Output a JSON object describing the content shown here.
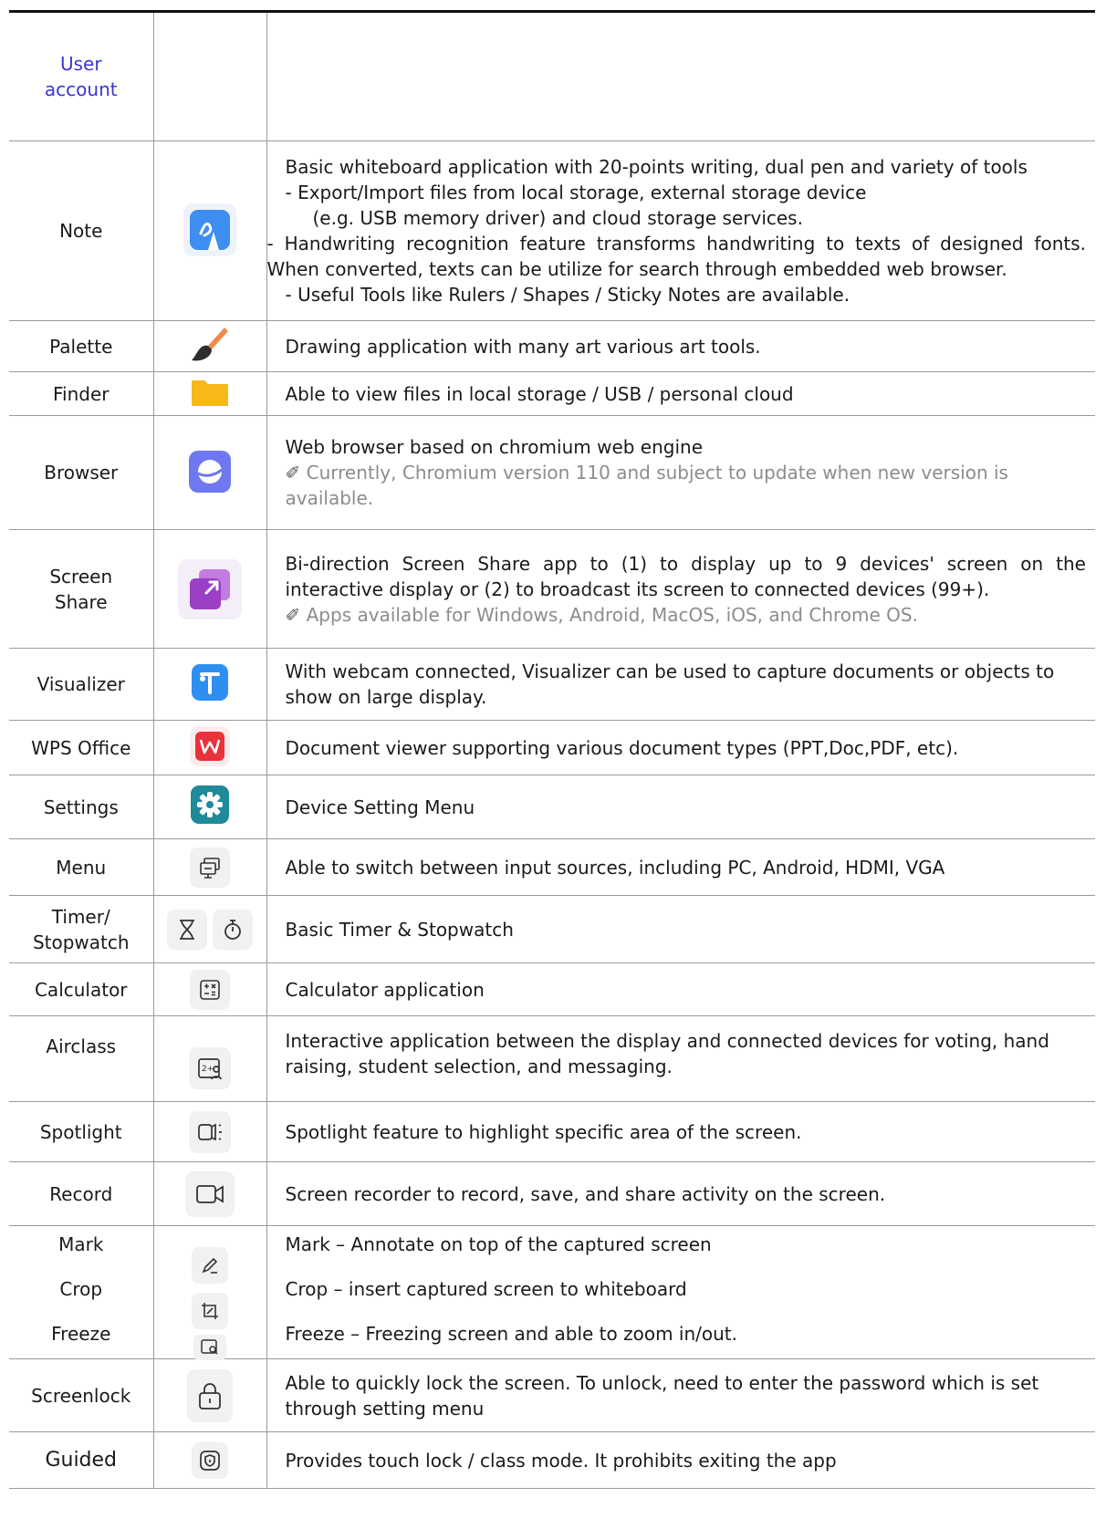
{
  "rows": [
    {
      "name": "User\naccount",
      "desc": []
    },
    {
      "name": "Note",
      "icon": "note-pen-icon",
      "desc": [
        "Basic whiteboard application with 20-points writing, dual pen and variety of tools",
        " - Export/Import files from local storage, external storage device",
        "   (e.g. USB memory driver) and cloud storage services.",
        " - Handwriting recognition feature transforms handwriting to texts of designed fonts. When converted, texts can be utilize for search through embedded web browser.",
        " - Useful Tools like Rulers / Shapes / Sticky Notes are available."
      ]
    },
    {
      "name": "Palette",
      "icon": "paintbrush-icon",
      "desc": [
        "Drawing application with many art various art tools."
      ]
    },
    {
      "name": "Finder",
      "icon": "folder-icon",
      "desc": [
        "Able to view files in local storage / USB / personal cloud"
      ]
    },
    {
      "name": "Browser",
      "icon": "browser-icon",
      "desc": [
        "Web browser based on chromium web engine"
      ],
      "note": "Currently, Chromium version 110 and subject to update when new version is available."
    },
    {
      "name": "Screen\nShare",
      "icon": "screen-share-icon",
      "desc": [
        "Bi-direction Screen Share app to (1) to display up to 9 devices' screen on the interactive display or (2) to broadcast its screen to connected devices (99+)."
      ],
      "note": "Apps available for Windows, Android, MacOS, iOS, and Chrome OS."
    },
    {
      "name": "Visualizer",
      "icon": "visualizer-icon",
      "desc": [
        "With webcam connected, Visualizer can be used to capture documents or objects to show on large display."
      ]
    },
    {
      "name": "WPS Office",
      "icon": "wps-office-icon",
      "desc": [
        "Document viewer supporting various document types (PPT,Doc,PDF, etc)."
      ]
    },
    {
      "name": "Settings",
      "icon": "gear-icon",
      "desc": [
        "Device Setting Menu"
      ]
    },
    {
      "name": "Menu",
      "icon": "input-source-icon",
      "desc": [
        "Able to switch between input sources, including PC, Android, HDMI, VGA"
      ]
    },
    {
      "name": "Timer/\nStopwatch",
      "icon": "hourglass-icon",
      "desc": [
        "Basic Timer & Stopwatch"
      ]
    },
    {
      "name": "Calculator",
      "icon": "calculator-icon",
      "desc": [
        "Calculator application"
      ]
    },
    {
      "name": "Airclass",
      "icon": "airclass-icon",
      "desc": [
        "Interactive application between the display and connected devices for voting, hand raising, student selection, and messaging."
      ]
    },
    {
      "name": "Spotlight",
      "icon": "spotlight-icon",
      "desc": [
        "Spotlight feature to highlight specific area of the screen."
      ]
    },
    {
      "name": "Record",
      "icon": "video-camera-icon",
      "desc": [
        "Screen recorder to record, save, and share activity on the screen."
      ]
    },
    {
      "names": [
        "Mark",
        "Crop",
        "Freeze"
      ],
      "icons": [
        "pencil-icon",
        "crop-icon",
        "freeze-icon"
      ],
      "desc": [
        "Mark – Annotate on top of the captured screen",
        "Crop – insert captured screen to whiteboard",
        "Freeze – Freezing screen and able to zoom in/out."
      ]
    },
    {
      "name": "Screenlock",
      "icon": "lock-icon",
      "desc": [
        "Able to quickly lock the screen. To unlock, need to enter the password which is set through setting menu"
      ]
    },
    {
      "name": "Guided",
      "icon": "guided-lock-icon",
      "desc": [
        "Provides touch lock / class mode. It prohibits exiting the app"
      ]
    }
  ],
  "note_glyph": "✐",
  "colors": {
    "link": "#3a34d6",
    "note": "#8c8c8c",
    "border": "#9a9a9a"
  }
}
